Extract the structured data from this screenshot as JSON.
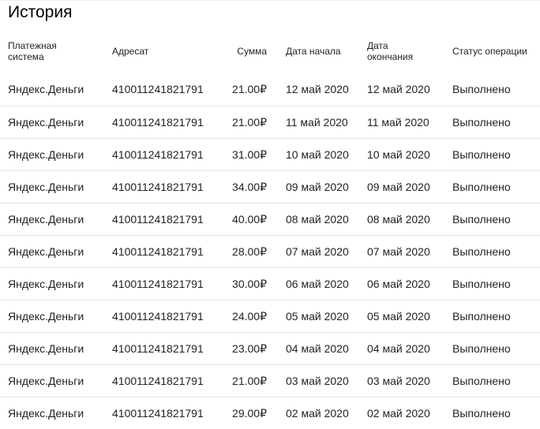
{
  "page": {
    "title": "История"
  },
  "table": {
    "headers": {
      "payment_system": "Платежная система",
      "recipient": "Адресат",
      "amount": "Сумма",
      "start_date": "Дата начала",
      "end_date": "Дата окончания",
      "status": "Статус операции"
    },
    "rows": [
      {
        "payment_system": "Яндекс.Деньги",
        "recipient": "410011241821791",
        "amount": "21.00₽",
        "start_date": "12 май 2020",
        "end_date": "12 май 2020",
        "status": "Выполнено"
      },
      {
        "payment_system": "Яндекс.Деньги",
        "recipient": "410011241821791",
        "amount": "21.00₽",
        "start_date": "11 май 2020",
        "end_date": "11 май 2020",
        "status": "Выполнено"
      },
      {
        "payment_system": "Яндекс.Деньги",
        "recipient": "410011241821791",
        "amount": "31.00₽",
        "start_date": "10 май 2020",
        "end_date": "10 май 2020",
        "status": "Выполнено"
      },
      {
        "payment_system": "Яндекс.Деньги",
        "recipient": "410011241821791",
        "amount": "34.00₽",
        "start_date": "09 май 2020",
        "end_date": "09 май 2020",
        "status": "Выполнено"
      },
      {
        "payment_system": "Яндекс.Деньги",
        "recipient": "410011241821791",
        "amount": "40.00₽",
        "start_date": "08 май 2020",
        "end_date": "08 май 2020",
        "status": "Выполнено"
      },
      {
        "payment_system": "Яндекс.Деньги",
        "recipient": "410011241821791",
        "amount": "28.00₽",
        "start_date": "07 май 2020",
        "end_date": "07 май 2020",
        "status": "Выполнено"
      },
      {
        "payment_system": "Яндекс.Деньги",
        "recipient": "410011241821791",
        "amount": "30.00₽",
        "start_date": "06 май 2020",
        "end_date": "06 май 2020",
        "status": "Выполнено"
      },
      {
        "payment_system": "Яндекс.Деньги",
        "recipient": "410011241821791",
        "amount": "24.00₽",
        "start_date": "05 май 2020",
        "end_date": "05 май 2020",
        "status": "Выполнено"
      },
      {
        "payment_system": "Яндекс.Деньги",
        "recipient": "410011241821791",
        "amount": "23.00₽",
        "start_date": "04 май 2020",
        "end_date": "04 май 2020",
        "status": "Выполнено"
      },
      {
        "payment_system": "Яндекс.Деньги",
        "recipient": "410011241821791",
        "amount": "21.00₽",
        "start_date": "03 май 2020",
        "end_date": "03 май 2020",
        "status": "Выполнено"
      },
      {
        "payment_system": "Яндекс.Деньги",
        "recipient": "410011241821791",
        "amount": "29.00₽",
        "start_date": "02 май 2020",
        "end_date": "02 май 2020",
        "status": "Выполнено"
      }
    ]
  }
}
